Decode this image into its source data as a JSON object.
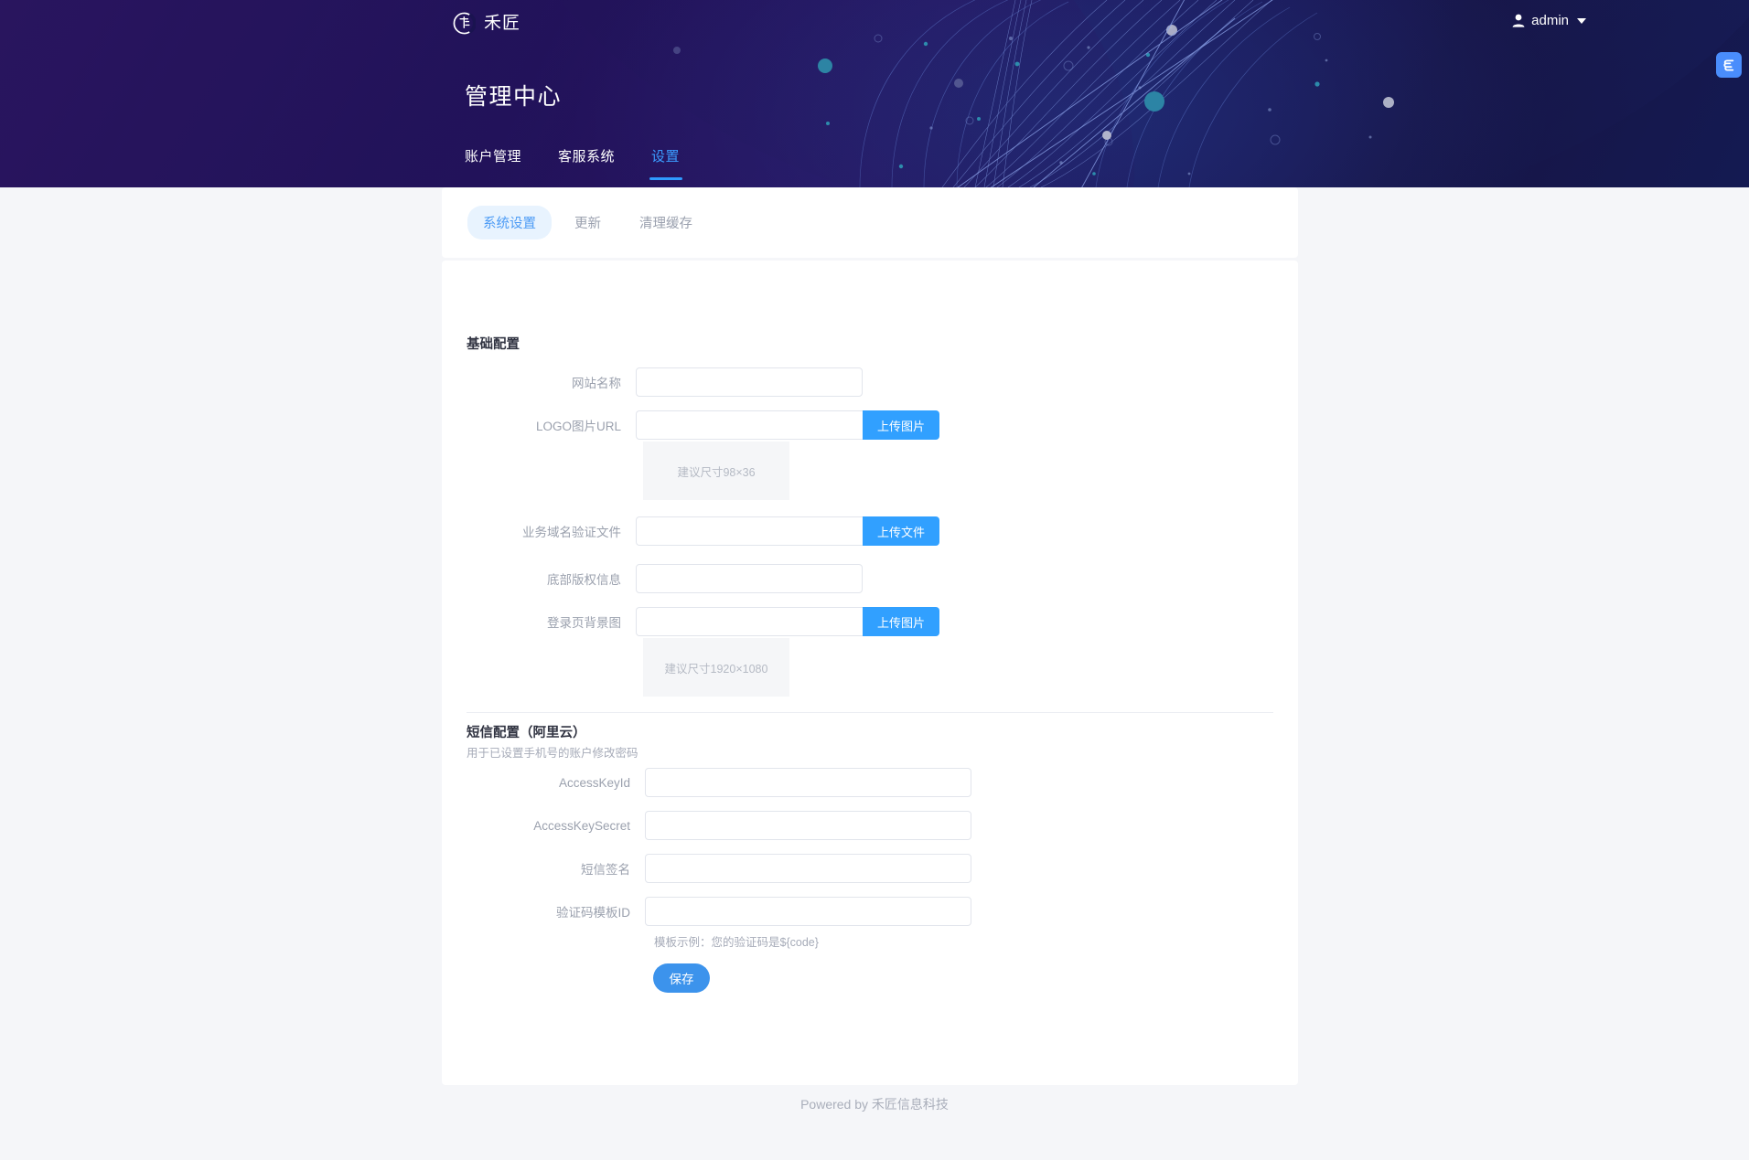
{
  "header": {
    "logo_text": "禾匠",
    "logo_icon": "circle-monogram-logo",
    "user_name": "admin",
    "user_icon": "person-icon",
    "caret_icon": "chevron-down-icon",
    "page_title": "管理中心",
    "tabs": [
      {
        "label": "账户管理",
        "active": false
      },
      {
        "label": "客服系统",
        "active": false
      },
      {
        "label": "设置",
        "active": true
      }
    ],
    "float_widget_icon": "s-logo-icon",
    "accent_color": "#2f9bff"
  },
  "subtabs": [
    {
      "label": "系统设置",
      "active": true
    },
    {
      "label": "更新",
      "active": false
    },
    {
      "label": "清理缓存",
      "active": false
    }
  ],
  "basic": {
    "section_title": "基础配置",
    "fields": {
      "site_name": {
        "label": "网站名称",
        "value": "",
        "placeholder": ""
      },
      "logo_url": {
        "label": "LOGO图片URL",
        "value": "",
        "placeholder": "",
        "button": "上传图片",
        "preview_hint": "建议尺寸98×36"
      },
      "domain_verify_file": {
        "label": "业务域名验证文件",
        "value": "",
        "placeholder": "",
        "button": "上传文件"
      },
      "footer_copyright": {
        "label": "底部版权信息",
        "value": "",
        "placeholder": ""
      },
      "login_bg": {
        "label": "登录页背景图",
        "value": "",
        "placeholder": "",
        "button": "上传图片",
        "preview_hint": "建议尺寸1920×1080"
      }
    }
  },
  "sms": {
    "section_title": "短信配置（阿里云）",
    "section_sub": "用于已设置手机号的账户修改密码",
    "fields": {
      "access_key_id": {
        "label": "AccessKeyId",
        "value": "",
        "placeholder": ""
      },
      "access_key_secret": {
        "label": "AccessKeySecret",
        "value": "",
        "placeholder": ""
      },
      "sign_name": {
        "label": "短信签名",
        "value": "",
        "placeholder": ""
      },
      "template_id": {
        "label": "验证码模板ID",
        "value": "",
        "placeholder": "",
        "hint": "模板示例：您的验证码是${code}"
      }
    }
  },
  "actions": {
    "save_label": "保存"
  },
  "footer": {
    "text": "Powered by 禾匠信息科技"
  }
}
